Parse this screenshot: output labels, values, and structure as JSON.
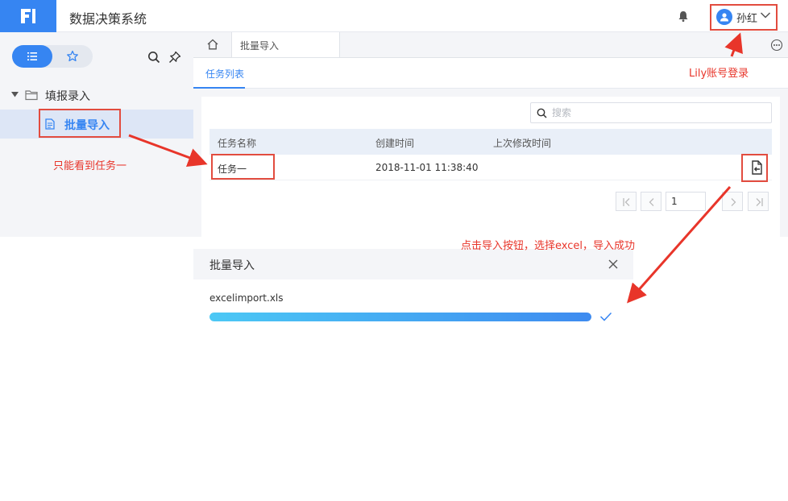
{
  "app": {
    "title": "数据决策系统",
    "user_name": "孙红",
    "brand_color": "#3685f2"
  },
  "sidebar": {
    "folder_label": "填报录入",
    "item_label": "批量导入"
  },
  "tabs": {
    "active_tab": "批量导入",
    "sub_tab": "任务列表"
  },
  "search": {
    "placeholder": "搜索"
  },
  "table": {
    "columns": [
      "任务名称",
      "创建时间",
      "上次修改时间"
    ],
    "rows": [
      {
        "name": "任务一",
        "created": "2018-11-01 11:38:40",
        "modified": ""
      }
    ]
  },
  "pager": {
    "current_page": "1"
  },
  "dialog": {
    "title": "批量导入",
    "file_name": "excelimport.xls",
    "progress_percent": 100
  },
  "annotations": {
    "login_note": "Lily账号登录",
    "visible_note": "只能看到任务一",
    "import_note": "点击导入按钮，选择excel，导入成功"
  }
}
